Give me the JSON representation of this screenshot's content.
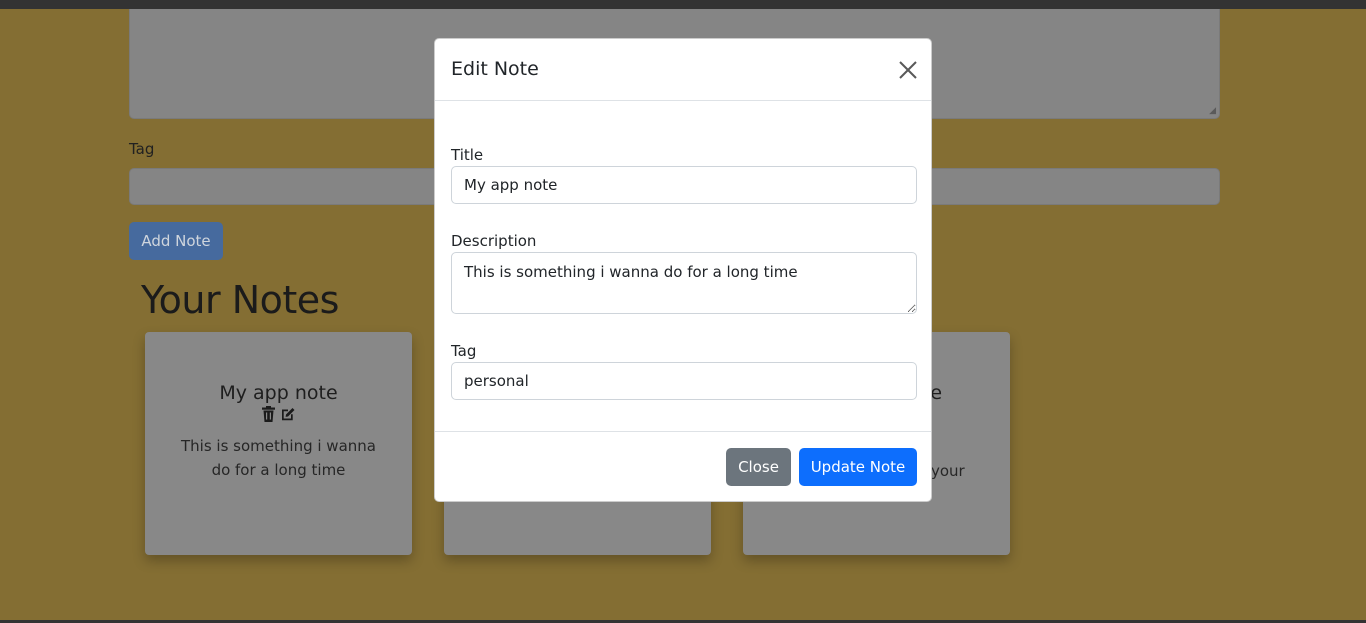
{
  "background_page": {
    "tag_label": "Tag",
    "add_button_label": "Add Note",
    "heading": "Your Notes",
    "cards": [
      {
        "title": "My app note",
        "description": "This is something i wanna do for a long time"
      },
      {
        "title": "",
        "description": ""
      },
      {
        "title_fragment": "nple",
        "description_fragment": "your"
      }
    ]
  },
  "modal": {
    "title": "Edit Note",
    "fields": {
      "title": {
        "label": "Title",
        "value": "My app note"
      },
      "description": {
        "label": "Description",
        "value": "This is something i wanna do for a long time"
      },
      "tag": {
        "label": "Tag",
        "value": "personal"
      }
    },
    "buttons": {
      "close": "Close",
      "update": "Update Note"
    }
  },
  "icons": {
    "modal_close": "close-x-icon",
    "card_delete": "trash-icon",
    "card_edit": "edit-icon"
  },
  "colors": {
    "overlay_background": "#846e33",
    "primary": "#0d6efd",
    "secondary": "#6c757d"
  }
}
